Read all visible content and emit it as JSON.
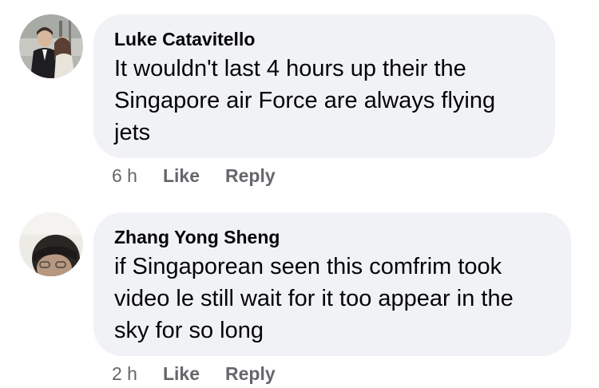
{
  "comments": [
    {
      "author": "Luke Catavitello",
      "text": "It wouldn't last 4 hours up their the Singapore air Force are always flying jets",
      "time": "6 h",
      "like_label": "Like",
      "reply_label": "Reply"
    },
    {
      "author": "Zhang Yong Sheng",
      "text": "if Singaporean seen this comfrim took video le still wait for it too appear in the sky for so long",
      "time": "2 h",
      "like_label": "Like",
      "reply_label": "Reply"
    }
  ],
  "colors": {
    "bubble": "#f0f2f5",
    "meta_text": "#65676b",
    "primary_text": "#050505"
  }
}
